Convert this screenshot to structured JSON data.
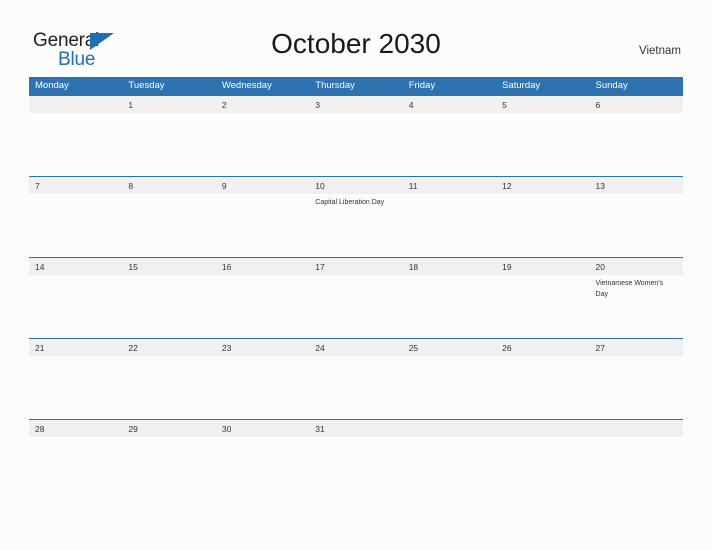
{
  "brand": {
    "name_part1": "General",
    "name_part2": "Blue",
    "triangle_icon": "triangle-icon",
    "accent_color": "#1f6fb8"
  },
  "header": {
    "title": "October 2030",
    "country": "Vietnam"
  },
  "calendar": {
    "header_bg": "#2e72b0",
    "band_bg": "#f0f0f0",
    "day_names": [
      "Monday",
      "Tuesday",
      "Wednesday",
      "Thursday",
      "Friday",
      "Saturday",
      "Sunday"
    ],
    "weeks": [
      [
        {
          "day": "",
          "event": ""
        },
        {
          "day": "1",
          "event": ""
        },
        {
          "day": "2",
          "event": ""
        },
        {
          "day": "3",
          "event": ""
        },
        {
          "day": "4",
          "event": ""
        },
        {
          "day": "5",
          "event": ""
        },
        {
          "day": "6",
          "event": ""
        }
      ],
      [
        {
          "day": "7",
          "event": ""
        },
        {
          "day": "8",
          "event": ""
        },
        {
          "day": "9",
          "event": ""
        },
        {
          "day": "10",
          "event": "Capital Liberation Day"
        },
        {
          "day": "11",
          "event": ""
        },
        {
          "day": "12",
          "event": ""
        },
        {
          "day": "13",
          "event": ""
        }
      ],
      [
        {
          "day": "14",
          "event": ""
        },
        {
          "day": "15",
          "event": ""
        },
        {
          "day": "16",
          "event": ""
        },
        {
          "day": "17",
          "event": ""
        },
        {
          "day": "18",
          "event": ""
        },
        {
          "day": "19",
          "event": ""
        },
        {
          "day": "20",
          "event": "Vietnamese Women's Day"
        }
      ],
      [
        {
          "day": "21",
          "event": ""
        },
        {
          "day": "22",
          "event": ""
        },
        {
          "day": "23",
          "event": ""
        },
        {
          "day": "24",
          "event": ""
        },
        {
          "day": "25",
          "event": ""
        },
        {
          "day": "26",
          "event": ""
        },
        {
          "day": "27",
          "event": ""
        }
      ],
      [
        {
          "day": "28",
          "event": ""
        },
        {
          "day": "29",
          "event": ""
        },
        {
          "day": "30",
          "event": ""
        },
        {
          "day": "31",
          "event": ""
        },
        {
          "day": "",
          "event": ""
        },
        {
          "day": "",
          "event": ""
        },
        {
          "day": "",
          "event": ""
        }
      ]
    ]
  }
}
